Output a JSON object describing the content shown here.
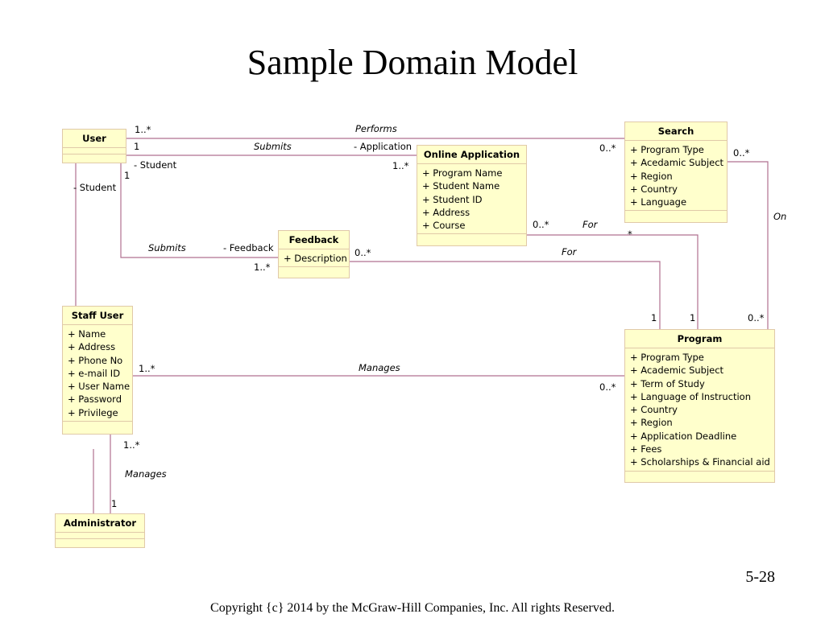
{
  "slide": {
    "title": "Sample Domain Model",
    "page_number": "5-28",
    "copyright": "Copyright {c} 2014 by the McGraw-Hill Companies, Inc. All rights Reserved."
  },
  "classes": {
    "user": {
      "name": "User",
      "attributes": []
    },
    "search": {
      "name": "Search",
      "attributes": [
        "+ Program Type",
        "+ Acedamic Subject",
        "+ Region",
        "+ Country",
        "+ Language"
      ]
    },
    "online_application": {
      "name": "Online Application",
      "attributes": [
        "+ Program Name",
        "+ Student Name",
        "+ Student ID",
        "+ Address",
        "+ Course"
      ]
    },
    "feedback": {
      "name": "Feedback",
      "attributes": [
        "+ Description"
      ]
    },
    "staff_user": {
      "name": "Staff User",
      "attributes": [
        "+ Name",
        "+ Address",
        "+ Phone No",
        "+ e-mail ID",
        "+ User Name",
        "+ Password",
        "+ Privilege"
      ]
    },
    "program": {
      "name": "Program",
      "attributes": [
        "+ Program Type",
        "+ Academic Subject",
        "+ Term of Study",
        "+ Language of Instruction",
        "+ Country",
        "+ Region",
        "+ Application Deadline",
        "+ Fees",
        "+ Scholarships  & Financial aid"
      ]
    },
    "administrator": {
      "name": "Administrator",
      "attributes": []
    }
  },
  "associations": {
    "performs": {
      "name": "Performs",
      "from_mult": "1..*",
      "to_mult": "0..*"
    },
    "submits_application": {
      "name": "Submits",
      "from_mult": "1",
      "from_role": "- Student",
      "to_role": "- Application",
      "to_mult": "1..*"
    },
    "submits_feedback": {
      "name": "Submits",
      "from_mult": "1",
      "from_role": "- Student",
      "to_role": "- Feedback",
      "to_mult": "1..*"
    },
    "generalization_role": {
      "role": "- Student"
    },
    "application_for": {
      "name": "For",
      "from_mult": "0..*",
      "to_mult": "*"
    },
    "feedback_for": {
      "name": "For",
      "from_mult": "0..*",
      "to_mult": "1"
    },
    "application_program_mult": {
      "to_mult": "1"
    },
    "search_on": {
      "name": "On",
      "from_mult": "0..*",
      "to_mult": "0..*"
    },
    "staff_manages_program": {
      "name": "Manages",
      "from_mult": "1..*",
      "to_mult": "0..*"
    },
    "admin_manages_staff": {
      "name": "Manages",
      "from_mult": "1..*",
      "to_mult": "1"
    }
  },
  "colors": {
    "class_fill": "#ffffcc",
    "class_border": "#e0c9a8",
    "line": "#b07090"
  }
}
